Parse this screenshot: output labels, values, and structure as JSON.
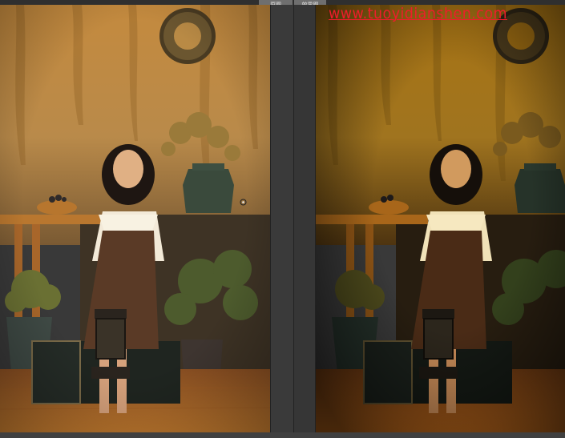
{
  "tabs": {
    "before_label": "原图",
    "after_label": "效果图"
  },
  "watermark": {
    "text": "www.tuoyidianshen.com",
    "color": "#ee1d2b"
  },
  "colors": {
    "ui_background": "#393939",
    "tab_background": "#6f6f6f",
    "before_wall": "#c1893f",
    "after_wall": "#b07a12"
  },
  "icons": {
    "scene_description": "photo-comparison",
    "cursor": "crosshair-icon"
  }
}
